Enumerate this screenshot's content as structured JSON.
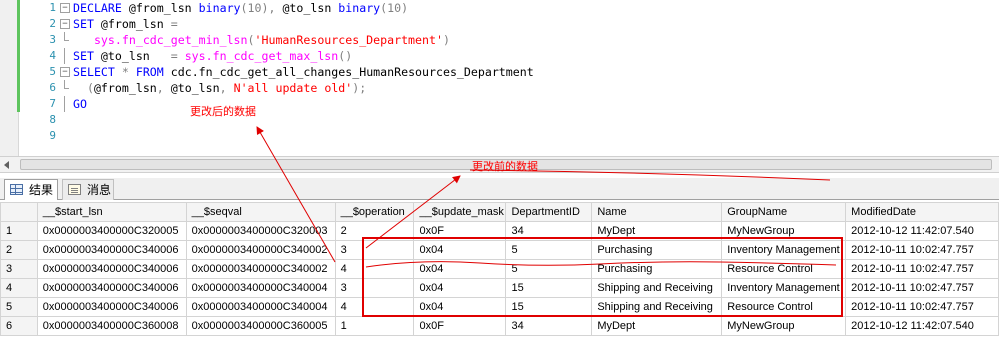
{
  "editor": {
    "lines": [
      {
        "num": "1",
        "marker": "minus",
        "segments": [
          {
            "cls": "kw",
            "text": "DECLARE "
          },
          {
            "cls": "plain",
            "text": "@from_lsn "
          },
          {
            "cls": "kw",
            "text": "binary"
          },
          {
            "cls": "gray",
            "text": "(10), "
          },
          {
            "cls": "plain",
            "text": "@to_lsn "
          },
          {
            "cls": "kw",
            "text": "binary"
          },
          {
            "cls": "gray",
            "text": "(10)"
          }
        ]
      },
      {
        "num": "2",
        "marker": "minus",
        "segments": [
          {
            "cls": "kw",
            "text": "SET "
          },
          {
            "cls": "plain",
            "text": "@from_lsn "
          },
          {
            "cls": "gray",
            "text": "="
          }
        ]
      },
      {
        "num": "3",
        "marker": "end",
        "segments": [
          {
            "cls": "plain",
            "text": "   "
          },
          {
            "cls": "fn",
            "text": "sys.fn_cdc_get_min_lsn"
          },
          {
            "cls": "gray",
            "text": "("
          },
          {
            "cls": "str",
            "text": "'HumanResources_Department'"
          },
          {
            "cls": "gray",
            "text": ")"
          }
        ]
      },
      {
        "num": "4",
        "marker": "none",
        "segments": [
          {
            "cls": "kw",
            "text": "SET "
          },
          {
            "cls": "plain",
            "text": "@to_lsn   "
          },
          {
            "cls": "gray",
            "text": "= "
          },
          {
            "cls": "fn",
            "text": "sys.fn_cdc_get_max_lsn"
          },
          {
            "cls": "gray",
            "text": "()"
          }
        ]
      },
      {
        "num": "5",
        "marker": "minus",
        "segments": [
          {
            "cls": "kw",
            "text": "SELECT "
          },
          {
            "cls": "gray",
            "text": "* "
          },
          {
            "cls": "kw",
            "text": "FROM "
          },
          {
            "cls": "plain",
            "text": "cdc.fn_cdc_get_all_changes_HumanResources_Department"
          }
        ]
      },
      {
        "num": "6",
        "marker": "end",
        "segments": [
          {
            "cls": "plain",
            "text": "  "
          },
          {
            "cls": "gray",
            "text": "("
          },
          {
            "cls": "plain",
            "text": "@from_lsn"
          },
          {
            "cls": "gray",
            "text": ", "
          },
          {
            "cls": "plain",
            "text": "@to_lsn"
          },
          {
            "cls": "gray",
            "text": ", "
          },
          {
            "cls": "str",
            "text": "N'all update old'"
          },
          {
            "cls": "gray",
            "text": ");"
          }
        ]
      },
      {
        "num": "7",
        "marker": "none",
        "segments": [
          {
            "cls": "kw",
            "text": "GO"
          }
        ]
      },
      {
        "num": "8",
        "marker": "none",
        "segments": []
      },
      {
        "num": "9",
        "marker": "none",
        "segments": []
      }
    ],
    "annotation_after": "更改后的数据",
    "annotation_before": "更改前的数据"
  },
  "tabs": {
    "results": "结果",
    "messages": "消息"
  },
  "grid": {
    "columns": [
      "__$start_lsn",
      "__$seqval",
      "__$operation",
      "__$update_mask",
      "DepartmentID",
      "Name",
      "GroupName",
      "ModifiedDate"
    ],
    "rows": [
      [
        "1",
        "0x0000003400000C320005",
        "0x0000003400000C320003",
        "2",
        "0x0F",
        "34",
        "MyDept",
        "MyNewGroup",
        "2012-10-12 11:42:07.540"
      ],
      [
        "2",
        "0x0000003400000C340006",
        "0x0000003400000C340002",
        "3",
        "0x04",
        "5",
        "Purchasing",
        "Inventory Management",
        "2012-10-11 10:02:47.757"
      ],
      [
        "3",
        "0x0000003400000C340006",
        "0x0000003400000C340002",
        "4",
        "0x04",
        "5",
        "Purchasing",
        "Resource Control",
        "2012-10-11 10:02:47.757"
      ],
      [
        "4",
        "0x0000003400000C340006",
        "0x0000003400000C340004",
        "3",
        "0x04",
        "15",
        "Shipping and Receiving",
        "Inventory Management",
        "2012-10-11 10:02:47.757"
      ],
      [
        "5",
        "0x0000003400000C340006",
        "0x0000003400000C340004",
        "4",
        "0x04",
        "15",
        "Shipping and Receiving",
        "Resource Control",
        "2012-10-11 10:02:47.757"
      ],
      [
        "6",
        "0x0000003400000C360008",
        "0x0000003400000C360005",
        "1",
        "0x0F",
        "34",
        "MyDept",
        "MyNewGroup",
        "2012-10-12 11:42:07.540"
      ]
    ]
  },
  "colors": {
    "annotation_red": "#e00000",
    "keyword_blue": "#0000ff",
    "function_magenta": "#ff00ff",
    "string_red": "#ff0000",
    "line_number": "#2b91af"
  }
}
